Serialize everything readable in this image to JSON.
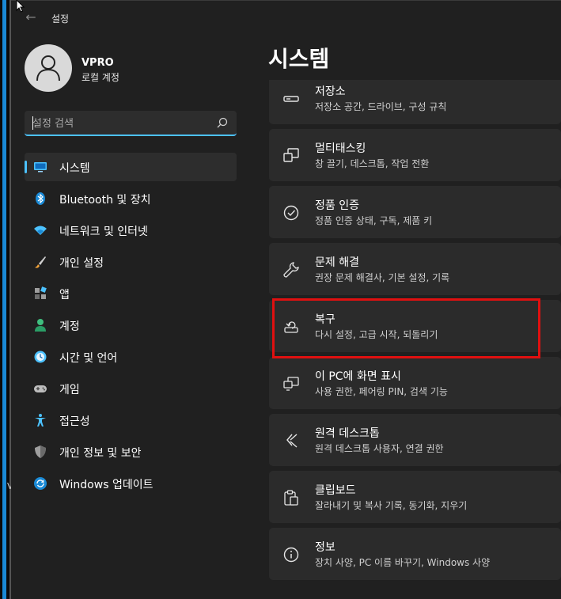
{
  "app": {
    "title": "설정",
    "back_icon": "back-arrow-icon"
  },
  "profile": {
    "name": "VPRO",
    "account_type": "로컬 계정"
  },
  "search": {
    "placeholder": "설정 검색",
    "value": ""
  },
  "sidebar": {
    "items": [
      {
        "label": "시스템",
        "icon": "monitor-icon",
        "active": true
      },
      {
        "label": "Bluetooth 및 장치",
        "icon": "bluetooth-icon"
      },
      {
        "label": "네트워크 및 인터넷",
        "icon": "wifi-icon"
      },
      {
        "label": "개인 설정",
        "icon": "brush-icon"
      },
      {
        "label": "앱",
        "icon": "apps-icon"
      },
      {
        "label": "계정",
        "icon": "account-icon"
      },
      {
        "label": "시간 및 언어",
        "icon": "clock-globe-icon"
      },
      {
        "label": "게임",
        "icon": "gamepad-icon"
      },
      {
        "label": "접근성",
        "icon": "accessibility-icon"
      },
      {
        "label": "개인 정보 및 보안",
        "icon": "shield-icon"
      },
      {
        "label": "Windows 업데이트",
        "icon": "update-icon"
      }
    ]
  },
  "main": {
    "title": "시스템",
    "cards": [
      {
        "title": "저장소",
        "subtitle": "저장소 공간, 드라이브, 구성 규칙",
        "icon": "storage-icon"
      },
      {
        "title": "멀티태스킹",
        "subtitle": "창 끌기, 데스크톱, 작업 전환",
        "icon": "multitasking-icon"
      },
      {
        "title": "정품 인증",
        "subtitle": "정품 인증 상태, 구독, 제품 키",
        "icon": "activation-check-icon"
      },
      {
        "title": "문제 해결",
        "subtitle": "권장 문제 해결사, 기본 설정, 기록",
        "icon": "wrench-icon"
      },
      {
        "title": "복구",
        "subtitle": "다시 설정, 고급 시작, 되돌리기",
        "icon": "recovery-icon"
      },
      {
        "title": "이 PC에 화면 표시",
        "subtitle": "사용 권한, 페어링 PIN, 검색 기능",
        "icon": "project-screen-icon"
      },
      {
        "title": "원격 데스크톱",
        "subtitle": "원격 데스크톱 사용자, 연결 권한",
        "icon": "remote-desktop-icon"
      },
      {
        "title": "클립보드",
        "subtitle": "잘라내기 및 복사 기록, 동기화, 지우기",
        "icon": "clipboard-icon"
      },
      {
        "title": "정보",
        "subtitle": "장치 사양, PC 이름 바꾸기, Windows 사양",
        "icon": "info-icon"
      }
    ]
  },
  "desktop": {
    "edge_letter": "V"
  },
  "colors": {
    "accent": "#4cc2ff",
    "highlight_box": "#e01010",
    "background": "#202020",
    "card": "#2b2b2b"
  }
}
